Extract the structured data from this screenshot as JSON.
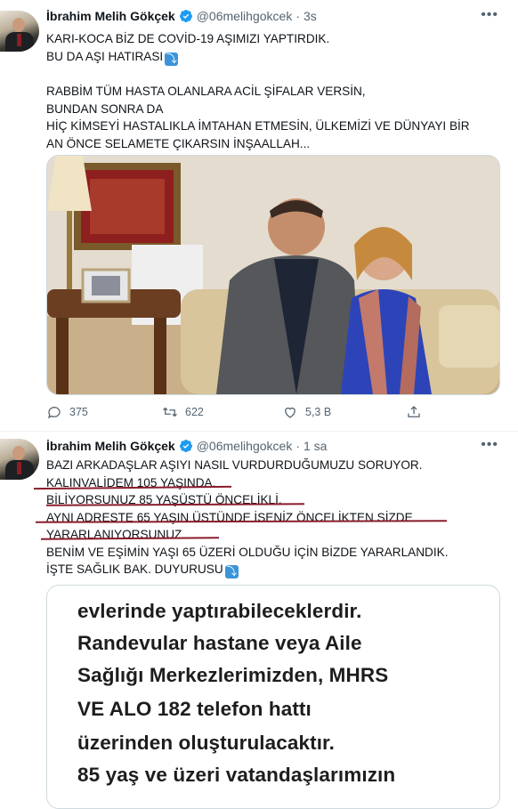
{
  "tweets": [
    {
      "author": "İbrahim Melih Gökçek",
      "handle": "@06melihgokcek",
      "time": "3s",
      "lines": [
        "KARI-KOCA BİZ DE COVİD-19 AŞIMIZI YAPTIRDIK.",
        "BU DA AŞI HATIRASI",
        "",
        "RABBİM TÜM HASTA OLANLARA ACİL ŞİFALAR VERSİN,",
        "BUNDAN SONRA DA",
        "HİÇ KİMSEYİ HASTALIKLA İMTAHAN ETMESİN, ÜLKEMİZİ VE DÜNYAYI BİR",
        "AN ÖNCE SELAMETE ÇIKARSIN İNŞAALLAH..."
      ],
      "stats": {
        "replies": "375",
        "retweets": "622",
        "likes": "5,3 B"
      }
    },
    {
      "author": "İbrahim Melih Gökçek",
      "handle": "@06melihgokcek",
      "time": "1 sa",
      "lines": [
        "BAZI ARKADAŞLAR AŞIYI NASIL VURDURDUĞUMUZU SORUYOR.",
        "KALINVALİDEM 105 YAŞINDA.",
        "BİLİYORSUNUZ 85 YAŞÜSTÜ ÖNCELİKLİ.",
        "AYNI ADRESTE 65 YAŞIN ÜSTÜNDE İSENİZ ÖNCELİKTEN SİZDE",
        "YARARLANIYORSUNUZ.",
        "BENİM VE EŞİMİN YAŞI 65 ÜZERİ OLDUĞU İÇİN BİZDE YARARLANDIK.",
        "İŞTE SAĞLIK BAK. DUYURUSU"
      ],
      "document_lines": [
        "evlerinde yaptırabileceklerdir.",
        "Randevular hastane veya Aile",
        "Sağlığı Merkezlerimizden, MHRS",
        "VE ALO 182 telefon hattı",
        "üzerinden oluşturulacaktır.",
        "85 yaş ve üzeri vatandaşlarımızın"
      ]
    }
  ],
  "colors": {
    "underline": "#8a1c2b",
    "verified": "#1d9bf0",
    "muted": "#536471"
  }
}
